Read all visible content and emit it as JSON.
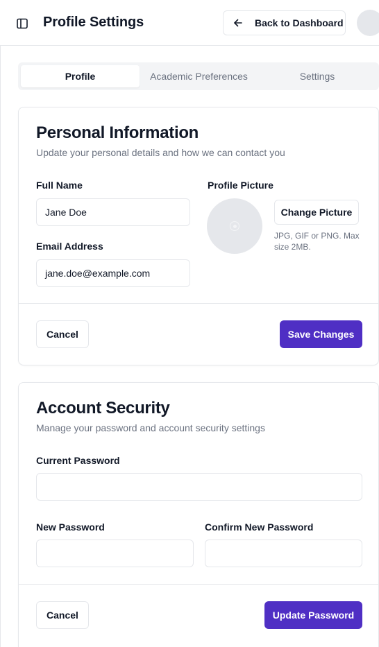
{
  "header": {
    "title": "Profile Settings",
    "back_label": "Back to Dashboard"
  },
  "tabs": [
    {
      "label": "Profile",
      "active": true
    },
    {
      "label": "Academic Preferences",
      "active": false
    },
    {
      "label": "Settings",
      "active": false
    }
  ],
  "personal": {
    "title": "Personal Information",
    "description": "Update your personal details and how we can contact you",
    "full_name_label": "Full Name",
    "full_name_value": "Jane Doe",
    "email_label": "Email Address",
    "email_value": "jane.doe@example.com",
    "picture_label": "Profile Picture",
    "change_picture_label": "Change Picture",
    "picture_hint": "JPG, GIF or PNG. Max size 2MB.",
    "cancel_label": "Cancel",
    "save_label": "Save Changes"
  },
  "security": {
    "title": "Account Security",
    "description": "Manage your password and account security settings",
    "current_password_label": "Current Password",
    "new_password_label": "New Password",
    "confirm_password_label": "Confirm New Password",
    "cancel_label": "Cancel",
    "update_label": "Update Password"
  },
  "colors": {
    "primary": "#4f2fc4",
    "border": "#e5e7eb",
    "muted_text": "#6b7280",
    "tab_background": "#f3f4f6"
  },
  "icons": {
    "sidebar_toggle": "sidebar-toggle-icon",
    "back": "arrow-left-icon",
    "profile_placeholder": "camera-icon"
  }
}
